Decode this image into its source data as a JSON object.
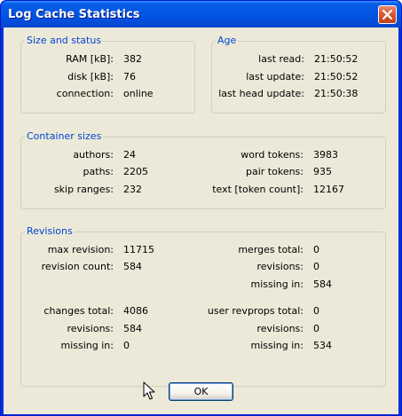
{
  "window": {
    "title": "Log Cache Statistics"
  },
  "size_status": {
    "legend": "Size and status",
    "rows": [
      {
        "label": "RAM [kB]:",
        "value": "382"
      },
      {
        "label": "disk [kB]:",
        "value": "76"
      },
      {
        "label": "connection:",
        "value": "online"
      }
    ]
  },
  "age": {
    "legend": "Age",
    "rows": [
      {
        "label": "last read:",
        "value": "21:50:52"
      },
      {
        "label": "last update:",
        "value": "21:50:52"
      },
      {
        "label": "last head update:",
        "value": "21:50:38"
      }
    ]
  },
  "container": {
    "legend": "Container sizes",
    "left": [
      {
        "label": "authors:",
        "value": "24"
      },
      {
        "label": "paths:",
        "value": "2205"
      },
      {
        "label": "skip ranges:",
        "value": "232"
      }
    ],
    "right": [
      {
        "label": "word tokens:",
        "value": "3983"
      },
      {
        "label": "pair tokens:",
        "value": "935"
      },
      {
        "label": "text [token count]:",
        "value": "12167"
      }
    ]
  },
  "revisions": {
    "legend": "Revisions",
    "left_top": [
      {
        "label": "max revision:",
        "value": "11715"
      },
      {
        "label": "revision count:",
        "value": "584"
      }
    ],
    "right_top": [
      {
        "label": "merges total:",
        "value": "0"
      },
      {
        "label": "revisions:",
        "value": "0"
      },
      {
        "label": "missing in:",
        "value": "584"
      }
    ],
    "left_bottom": [
      {
        "label": "changes total:",
        "value": "4086"
      },
      {
        "label": "revisions:",
        "value": "584"
      },
      {
        "label": "missing in:",
        "value": "0"
      }
    ],
    "right_bottom": [
      {
        "label": "user revprops total:",
        "value": "0"
      },
      {
        "label": "revisions:",
        "value": "0"
      },
      {
        "label": "missing in:",
        "value": "534"
      }
    ]
  },
  "buttons": {
    "ok": "OK"
  },
  "icons": {
    "close": "close-icon",
    "cursor": "mouse-pointer-icon"
  },
  "colors": {
    "titlebar": "#0a5fe8",
    "legend": "#0046d5",
    "dialog_bg": "#ece9d8",
    "close": "#d6552d"
  }
}
